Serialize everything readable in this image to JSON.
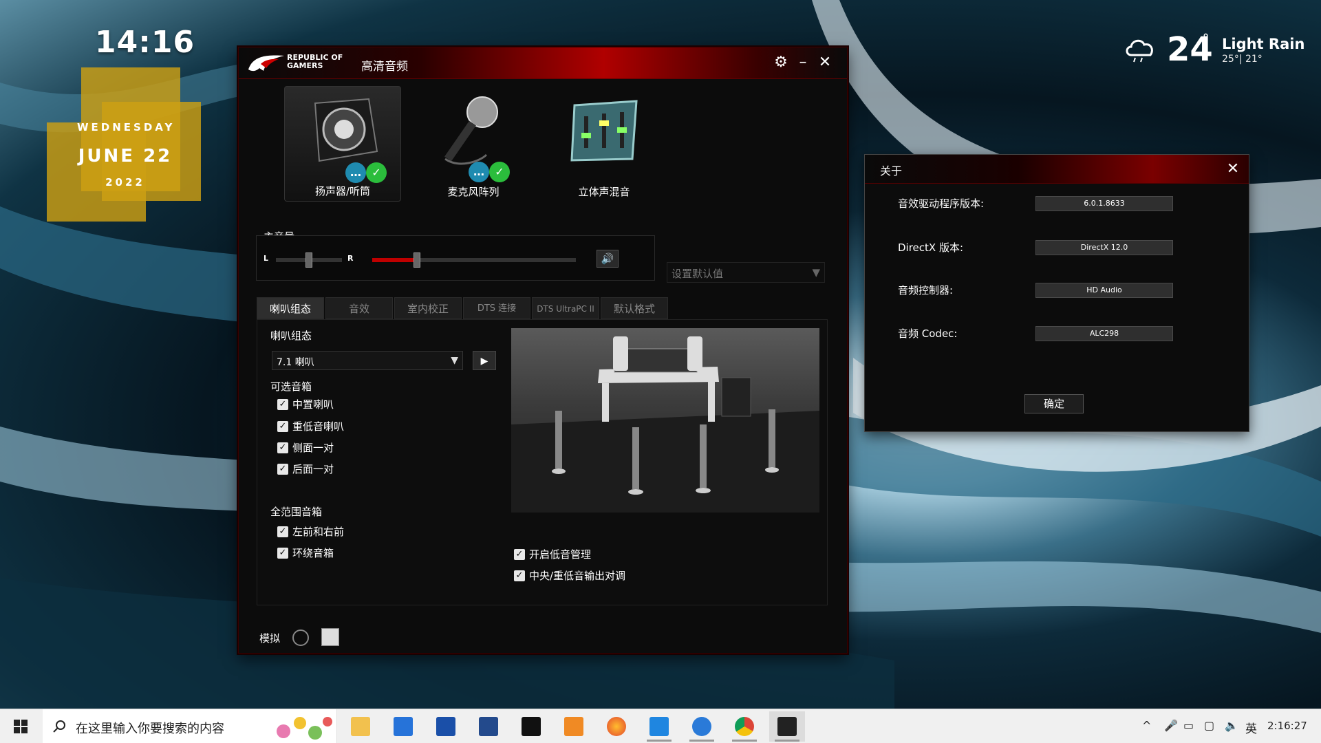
{
  "desktop": {
    "clock": {
      "time": "14:16",
      "weekday": "WEDNESDAY",
      "month_day": "JUNE 22",
      "year": "2022"
    },
    "weather": {
      "icon": "cloud-rain-icon",
      "temperature": "24",
      "degree": "°",
      "condition": "Light Rain",
      "range": "25°| 21°"
    }
  },
  "rog_window": {
    "brand": "REPUBLIC OF GAMERS",
    "title": "高清音频",
    "devices": [
      {
        "label": "扬声器/听筒",
        "icon": "speaker-icon"
      },
      {
        "label": "麦克风阵列",
        "icon": "microphone-icon"
      },
      {
        "label": "立体声混音",
        "icon": "mixer-icon"
      }
    ],
    "master_volume": {
      "label": "主音量",
      "balance_left": "L",
      "balance_right": "R",
      "balance_level": 0.5,
      "volume_level": 0.22
    },
    "default_dropdown": "设置默认值",
    "tabs": [
      "喇叭组态",
      "音效",
      "室内校正",
      "DTS 连接",
      "DTS UltraPC II",
      "默认格式"
    ],
    "speaker_config": {
      "label": "喇叭组态",
      "selected": "7.1 喇叭",
      "optional_label": "可选音箱",
      "optional": [
        "中置喇叭",
        "重低音喇叭",
        "侧面一对",
        "后面一对"
      ],
      "fullrange_label": "全范围音箱",
      "fullrange": [
        "左前和右前",
        "环绕音箱"
      ],
      "bass": [
        "开启低音管理",
        "中央/重低音输出对调"
      ]
    },
    "footer_label": "模拟"
  },
  "about_dialog": {
    "title": "关于",
    "rows": [
      {
        "label": "音效驱动程序版本:",
        "value": "6.0.1.8633"
      },
      {
        "label": "DirectX 版本:",
        "value": "DirectX 12.0"
      },
      {
        "label": "音频控制器:",
        "value": "HD Audio"
      },
      {
        "label": "音频 Codec:",
        "value": "ALC298"
      }
    ],
    "ok": "确定"
  },
  "taskbar": {
    "search_placeholder": "在这里输入你要搜索的内容",
    "apps": [
      "file-explorer-icon",
      "store-icon",
      "dolby-access-icon",
      "dolby-icon",
      "dolby-audio-icon",
      "app-orange-icon",
      "firefox-icon",
      "app-blue-arrow-icon",
      "sogou-icon",
      "chrome-icon",
      "rog-audio-icon"
    ],
    "ime": "英",
    "time": "2:16:27"
  },
  "colors": {
    "accent_red": "#c00000",
    "check_green": "#2bbd3c",
    "gold": "#cda014"
  }
}
